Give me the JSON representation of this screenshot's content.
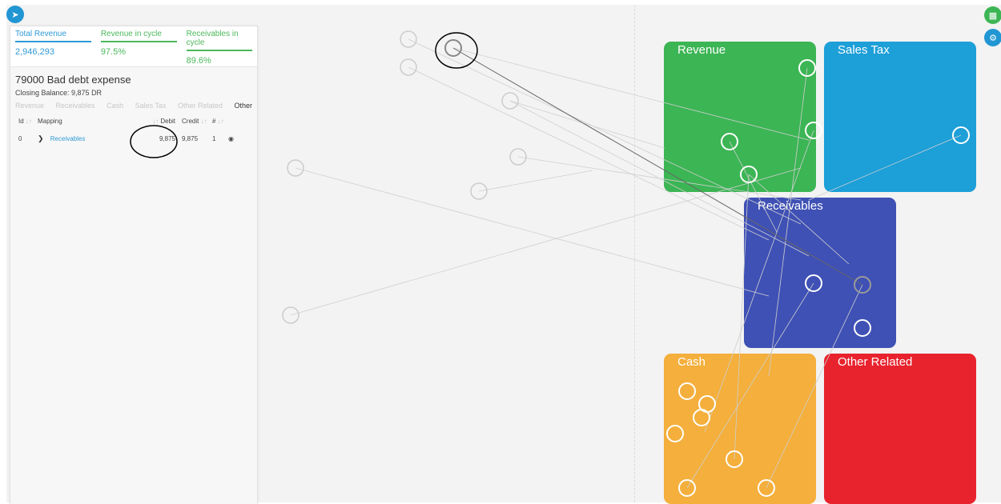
{
  "toolbar": {
    "nav_icon": "navigation-arrow-icon",
    "save_icon": "save-icon",
    "settings_icon": "gear-icon"
  },
  "kpis": {
    "total_revenue": {
      "label": "Total Revenue",
      "value": "2,946,293"
    },
    "revenue_in_cycle": {
      "label": "Revenue in cycle",
      "value": "97.5%"
    },
    "receivables_in_cycle": {
      "label": "Receivables in cycle",
      "value": "89.6%"
    }
  },
  "account": {
    "title": "79000  Bad debt expense",
    "closing_balance": "Closing Balance: 9,875 DR",
    "tabs": [
      "Revenue",
      "Receivables",
      "Cash",
      "Sales Tax",
      "Other Related",
      "Other"
    ],
    "active_tab": "Other"
  },
  "table": {
    "headers": {
      "id": "Id",
      "mapping": "Mapping",
      "debit": "Debit",
      "credit": "Credit",
      "num": "#"
    },
    "sort_glyph": "↓↑",
    "rows": [
      {
        "id": "0",
        "mapping": "Receivables",
        "debit": "9,875",
        "credit": "9,875",
        "num": "1"
      }
    ]
  },
  "categories": {
    "revenue": {
      "label": "Revenue",
      "color": "#3cb554"
    },
    "sales_tax": {
      "label": "Sales Tax",
      "color": "#1d9fd8"
    },
    "receivables": {
      "label": "Receivables",
      "color": "#3f51b5"
    },
    "cash": {
      "label": "Cash",
      "color": "#f4af3c"
    },
    "other_related": {
      "label": "Other Related",
      "color": "#e8232d"
    }
  }
}
